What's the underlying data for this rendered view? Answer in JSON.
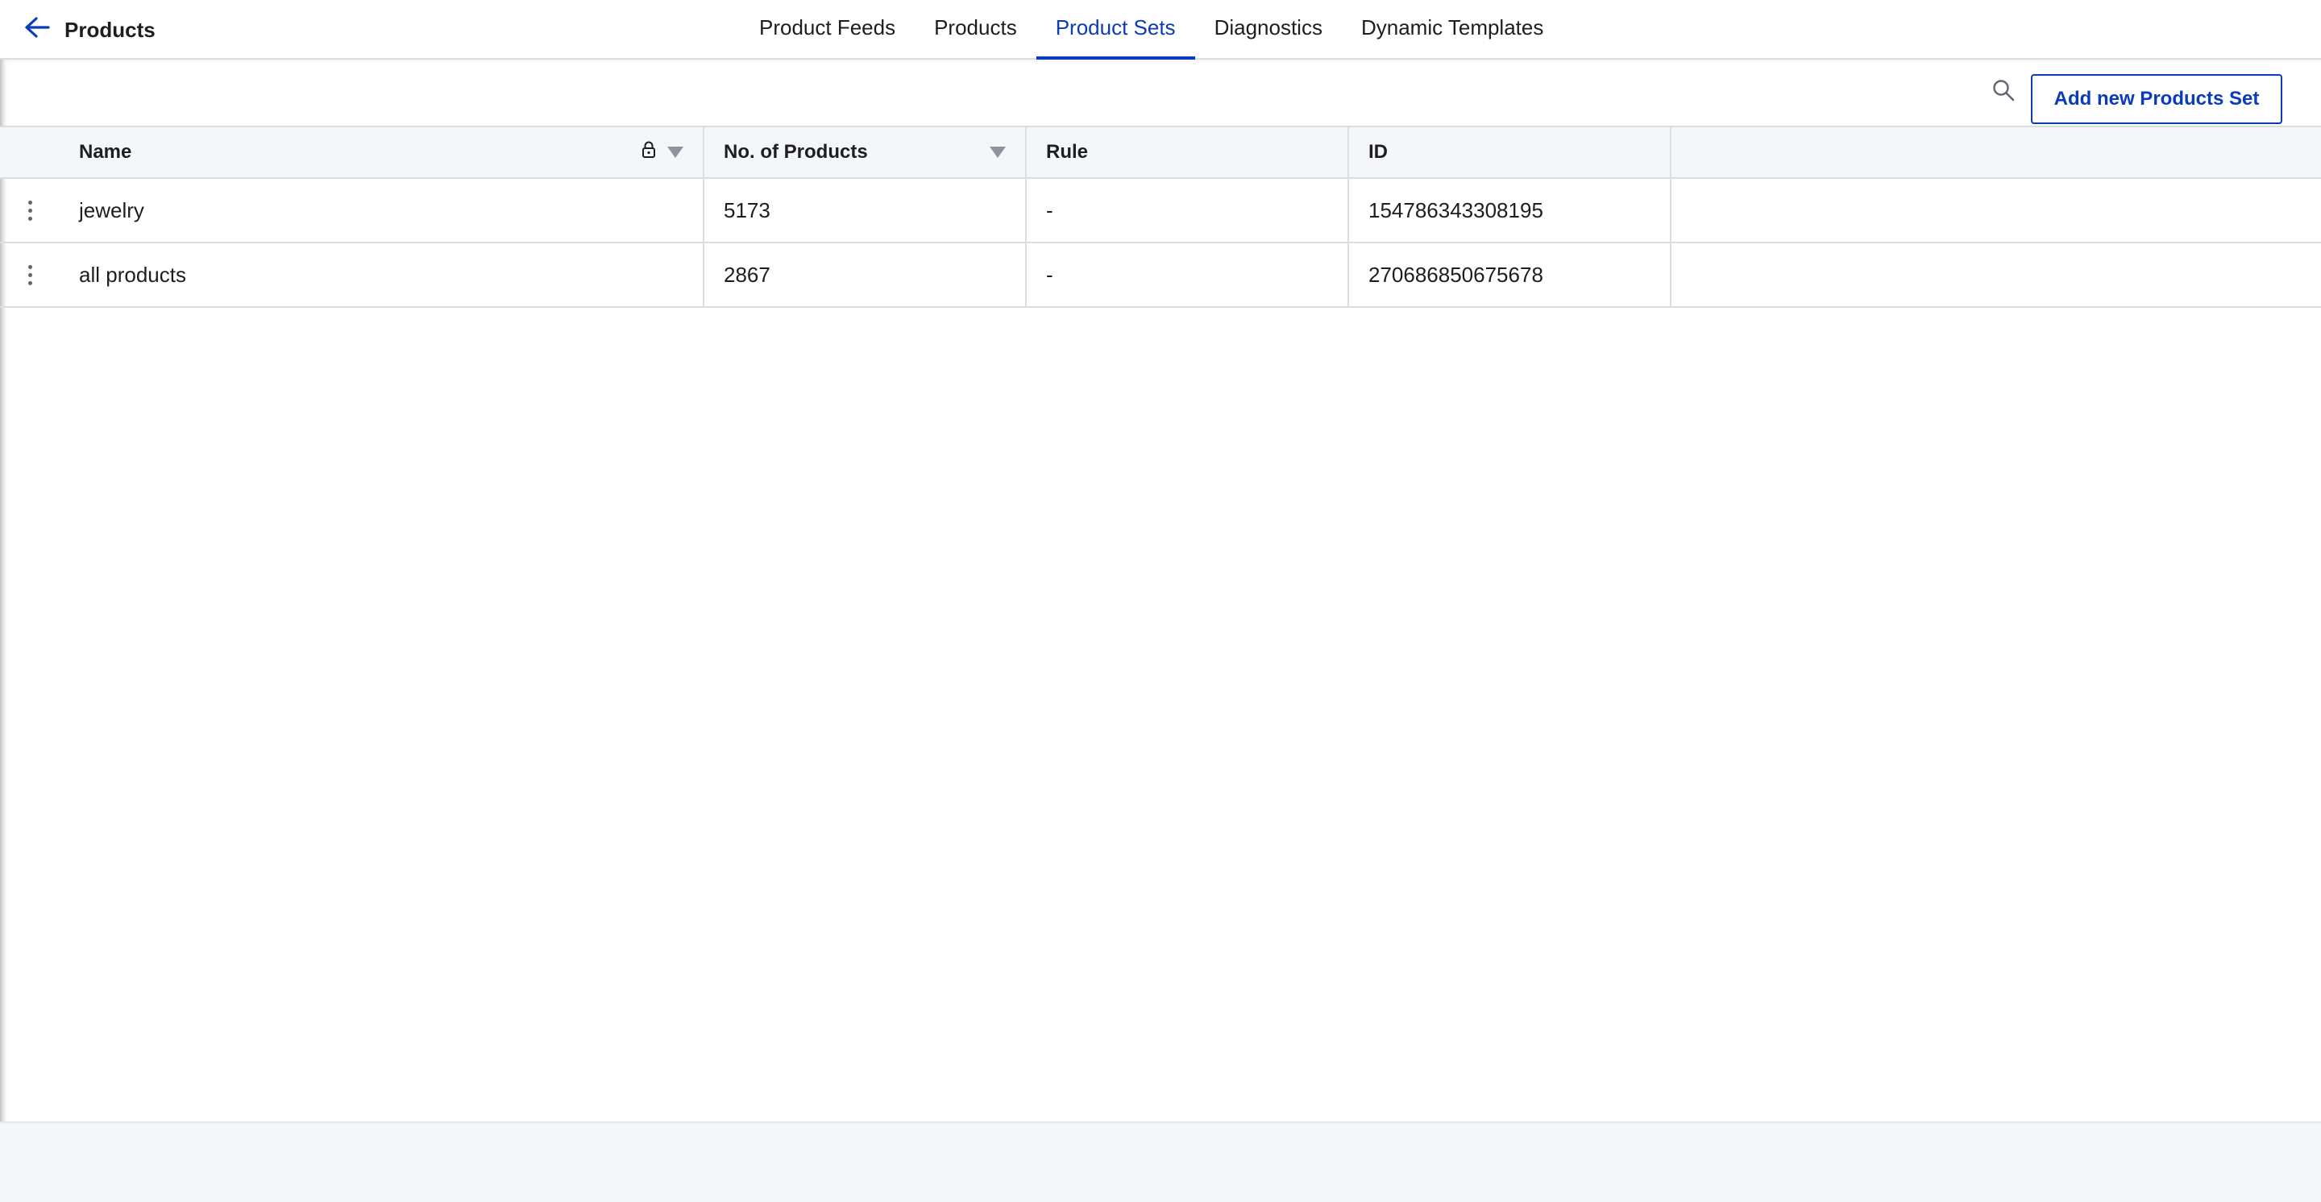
{
  "header": {
    "back_icon": "arrow-left-icon",
    "title": "Products",
    "tabs": [
      {
        "label": "Product Feeds"
      },
      {
        "label": "Products"
      },
      {
        "label": "Product Sets"
      },
      {
        "label": "Diagnostics"
      },
      {
        "label": "Dynamic Templates"
      }
    ],
    "active_tab": "Product Sets",
    "accent_color": "#0a3bb8"
  },
  "toolbar": {
    "search_icon": "search-icon",
    "add_button_label": "Add new Products Set"
  },
  "table": {
    "columns": [
      "Name",
      "No. of Products",
      "Rule",
      "ID"
    ],
    "rows": [
      {
        "name": "jewelry",
        "count": "5173",
        "rule": "-",
        "id": "154786343308195"
      },
      {
        "name": "all products",
        "count": "2867",
        "rule": "-",
        "id": "270686850675678"
      }
    ]
  }
}
